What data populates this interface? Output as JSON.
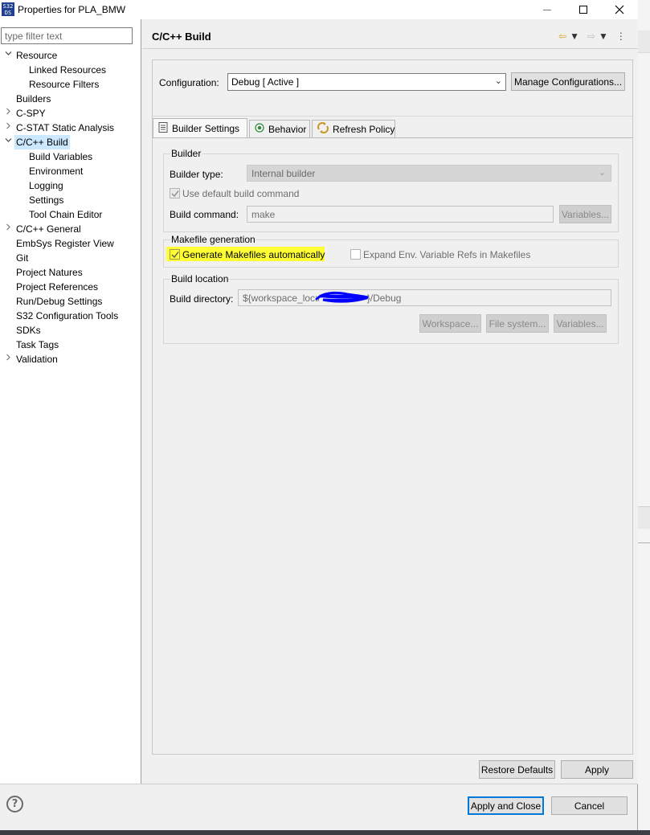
{
  "window": {
    "title": "Properties for PLA_BMW",
    "app_icon_text": "S32\nDS"
  },
  "left": {
    "filter_placeholder": "type filter text",
    "tree": [
      {
        "label": "Resource",
        "level": 0,
        "arrow": "expanded"
      },
      {
        "label": "Linked Resources",
        "level": 1
      },
      {
        "label": "Resource Filters",
        "level": 1
      },
      {
        "label": "Builders",
        "level": 0
      },
      {
        "label": "C-SPY",
        "level": 0,
        "arrow": "collapsed"
      },
      {
        "label": "C-STAT Static Analysis",
        "level": 0,
        "arrow": "collapsed"
      },
      {
        "label": "C/C++ Build",
        "level": 0,
        "arrow": "expanded",
        "selected": true
      },
      {
        "label": "Build Variables",
        "level": 1
      },
      {
        "label": "Environment",
        "level": 1
      },
      {
        "label": "Logging",
        "level": 1
      },
      {
        "label": "Settings",
        "level": 1
      },
      {
        "label": "Tool Chain Editor",
        "level": 1
      },
      {
        "label": "C/C++ General",
        "level": 0,
        "arrow": "collapsed"
      },
      {
        "label": "EmbSys Register View",
        "level": 0
      },
      {
        "label": "Git",
        "level": 0
      },
      {
        "label": "Project Natures",
        "level": 0
      },
      {
        "label": "Project References",
        "level": 0
      },
      {
        "label": "Run/Debug Settings",
        "level": 0
      },
      {
        "label": "S32 Configuration Tools",
        "level": 0
      },
      {
        "label": "SDKs",
        "level": 0
      },
      {
        "label": "Task Tags",
        "level": 0
      },
      {
        "label": "Validation",
        "level": 0,
        "arrow": "collapsed"
      }
    ]
  },
  "main": {
    "title": "C/C++ Build",
    "configuration_label": "Configuration:",
    "configuration_value": "Debug  [ Active ]",
    "manage_button": "Manage Configurations...",
    "tabs": [
      {
        "label": "Builder Settings",
        "icon": "builder-settings-icon",
        "active": true
      },
      {
        "label": "Behavior",
        "icon": "behavior-icon"
      },
      {
        "label": "Refresh Policy",
        "icon": "refresh-policy-icon"
      }
    ],
    "builder_group": {
      "title": "Builder",
      "builder_type_label": "Builder type:",
      "builder_type_value": "Internal builder",
      "use_default_label": "Use default build command",
      "build_command_label": "Build command:",
      "build_command_value": "make",
      "variables_button": "Variables..."
    },
    "makefile_group": {
      "title": "Makefile generation",
      "generate_label": "Generate Makefiles automatically",
      "expand_label": "Expand Env. Variable Refs in Makefiles"
    },
    "location_group": {
      "title": "Build location",
      "build_dir_label": "Build directory:",
      "build_dir_prefix": "${workspace_loc:/",
      "build_dir_suffix": "}/Debug",
      "workspace_button": "Workspace...",
      "filesystem_button": "File system...",
      "variables_button": "Variables..."
    },
    "restore_defaults_button": "Restore Defaults",
    "apply_button": "Apply"
  },
  "footer": {
    "help_icon_text": "?",
    "apply_close_button": "Apply and Close",
    "cancel_button": "Cancel"
  },
  "colors": {
    "selection": "#cce8ff",
    "highlight": "#ffff33",
    "scribble": "#0000ff",
    "primary_border": "#0078d7"
  }
}
